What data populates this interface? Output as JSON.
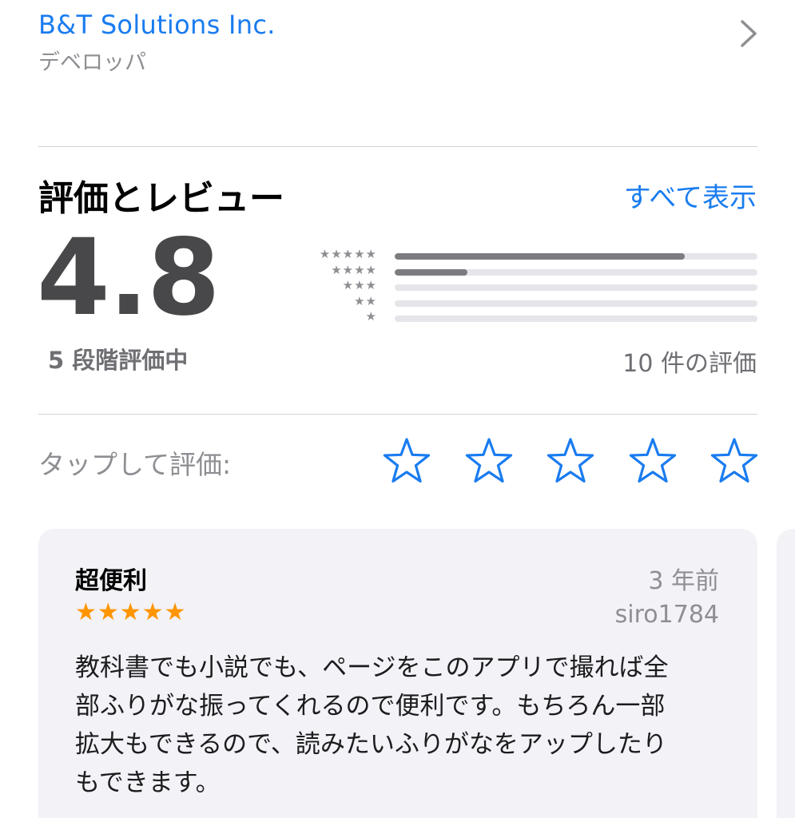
{
  "developer": {
    "name": "B&T Solutions Inc.",
    "role_label": "デベロッパ",
    "chevron_icon": "chevron-right-icon"
  },
  "ratings": {
    "title": "評価とレビュー",
    "see_all_label": "すべて表示",
    "average": "4.8",
    "out_of_label": "5 段階評価中",
    "count_label": "10 件の評価",
    "histogram": [
      {
        "stars": 5,
        "stars_text": "★★★★★",
        "fraction": 0.8
      },
      {
        "stars": 4,
        "stars_text": "★★★★",
        "fraction": 0.2
      },
      {
        "stars": 3,
        "stars_text": "★★★",
        "fraction": 0.0
      },
      {
        "stars": 2,
        "stars_text": "★★",
        "fraction": 0.0
      },
      {
        "stars": 1,
        "stars_text": "★",
        "fraction": 0.0
      }
    ],
    "bar_color": "#7c7c80",
    "track_color": "#e5e5ea"
  },
  "tap_to_rate": {
    "label": "タップして評価:",
    "star_count": 5,
    "star_icon": "star-outline-icon",
    "star_color": "#1a7cf0"
  },
  "review": {
    "title": "超便利",
    "date": "3 年前",
    "rating": 5,
    "stars_text": "★★★★★",
    "star_color": "#ff9500",
    "author": "siro1784",
    "body_lines": [
      "教科書でも小説でも、ページをこのアプリで撮れば全",
      "部ふりがな振ってくれるので便利です。もちろん一部",
      "拡大もできるので、読みたいふりがなをアップしたり",
      "もできます。"
    ]
  },
  "colors": {
    "accent": "#1a7cf0",
    "secondary_text": "#8e8e93",
    "card_background": "#f2f2f7"
  }
}
